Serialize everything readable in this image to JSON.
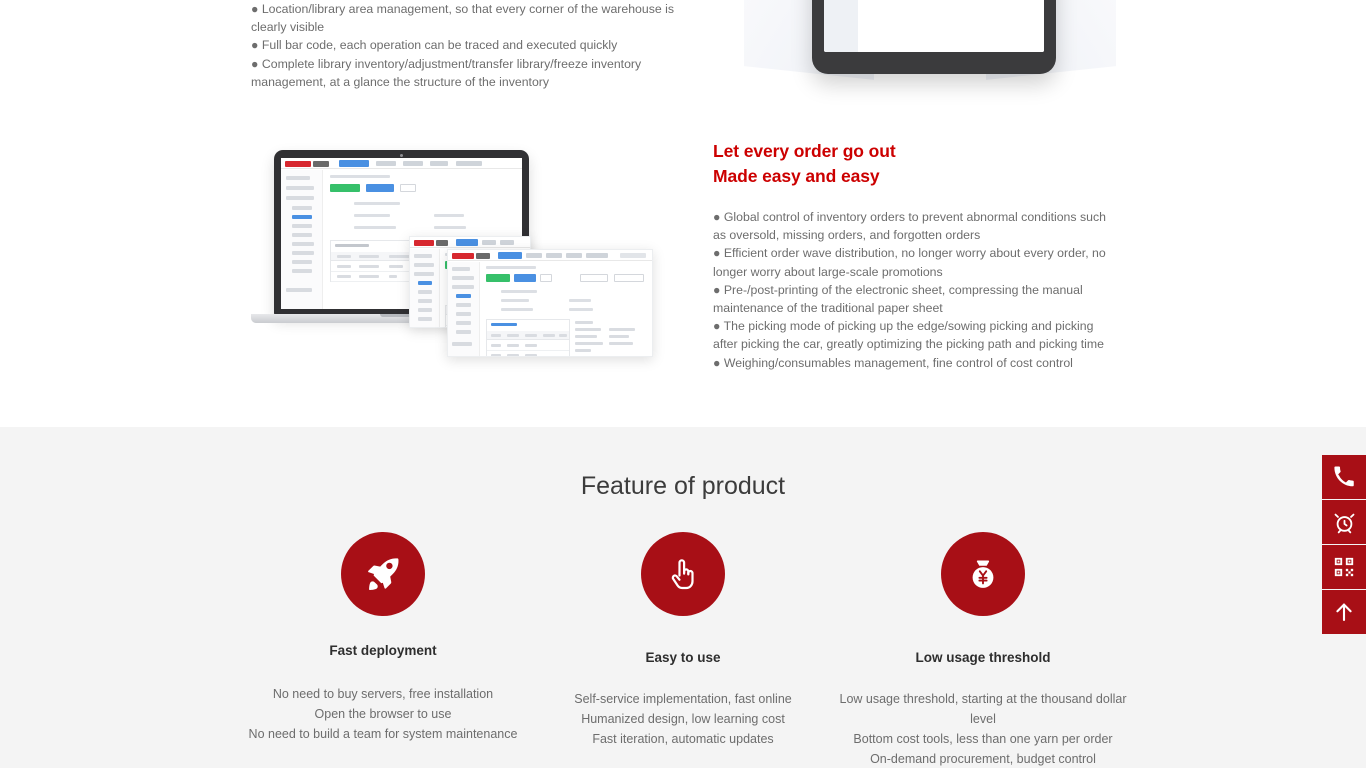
{
  "colors": {
    "brand_red": "#a80f16",
    "heading_red": "#cc0000",
    "section_gray_bg": "#f4f4f4",
    "body_text": "#6d6d6d",
    "title_text": "#3c3c3c"
  },
  "inventory_block": {
    "bullets": [
      "● Location/library area management, so that every corner of the warehouse is clearly visible",
      "● Full bar code, each operation can be traced and executed quickly",
      "● Complete library inventory/adjustment/transfer library/freeze inventory management, at a glance the structure of the inventory"
    ]
  },
  "order_block": {
    "heading_line1": "Let every order go out",
    "heading_line2": "Made easy and easy",
    "bullets": [
      "● Global control of inventory orders to prevent abnormal conditions such as oversold, missing orders, and forgotten orders",
      "● Efficient order wave distribution, no longer worry about every order, no longer worry about large-scale promotions",
      "● Pre-/post-printing of the electronic sheet, compressing the manual maintenance of the traditional paper sheet",
      "● The picking mode of picking up the edge/sowing picking and picking after picking the car, greatly optimizing the picking path and picking time",
      "● Weighing/consumables management, fine control of cost control"
    ]
  },
  "features": {
    "section_title": "Feature of product",
    "items": [
      {
        "icon": "rocket-icon",
        "title": "Fast deployment",
        "lines": [
          "No need to buy servers, free installation",
          "Open the browser to use",
          "No need to build a team for system maintenance"
        ]
      },
      {
        "icon": "pointing-hand-icon",
        "title": "Easy to use",
        "lines": [
          "Self-service implementation, fast online",
          "Humanized design, low learning cost",
          "Fast iteration, automatic updates"
        ]
      },
      {
        "icon": "money-bag-icon",
        "title": "Low usage threshold",
        "lines": [
          "Low usage threshold, starting at the thousand dollar level",
          "Bottom cost tools, less than one yarn per order",
          "On-demand procurement, budget control"
        ]
      }
    ]
  },
  "side_rail": {
    "buttons": [
      {
        "icon": "phone-icon",
        "name": "contact-phone"
      },
      {
        "icon": "alarm-clock-icon",
        "name": "reminder"
      },
      {
        "icon": "qr-code-icon",
        "name": "qr-code"
      },
      {
        "icon": "arrow-up-icon",
        "name": "back-to-top"
      }
    ]
  }
}
